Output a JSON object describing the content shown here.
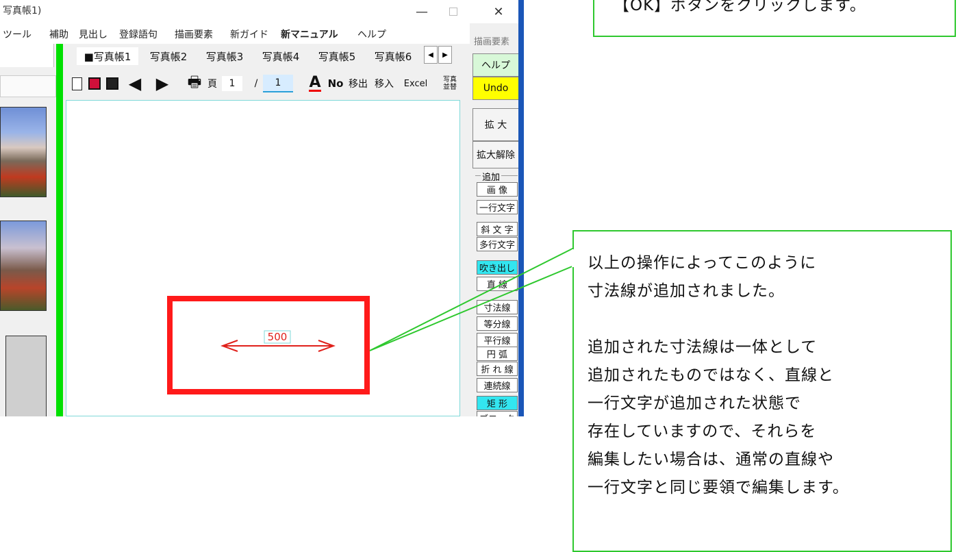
{
  "window": {
    "title": "写真帳1)",
    "minimize_icon": "minimize-icon",
    "maximize_icon": "maximize-icon",
    "close_icon": "close-icon"
  },
  "menu": [
    "ツール",
    "補助",
    "見出し",
    "登録語句",
    "描画要素",
    "新ガイド",
    "新マニュアル",
    "ヘルプ"
  ],
  "tabs": [
    "■写真帳1",
    "写真帳2",
    "写真帳3",
    "写真帳4",
    "写真帳5",
    "写真帳6"
  ],
  "toolbar": {
    "page_label": "頁",
    "page_current": "1",
    "page_separator": "/",
    "page_total": "1",
    "move_out": "移出",
    "move_in": "移入",
    "excel": "Excel",
    "photo_sort_1": "写真",
    "photo_sort_2": "並替",
    "number_icon": "No"
  },
  "right_panel": {
    "header": "描画要素",
    "help": "ヘルプ",
    "undo": "Undo",
    "zoom": "拡 大",
    "zoom_off": "拡大解除",
    "add_label": "追加",
    "items": [
      "画 像",
      "一行文字",
      "斜 文 字",
      "多行文字",
      "吹き出し",
      "直 線",
      "寸法線",
      "等分線",
      "平行線",
      "円 弧",
      "折 れ 線",
      "連続線",
      "矩 形",
      "ブロック"
    ]
  },
  "canvas": {
    "dimension_value": "500"
  },
  "callout_top": "【OK】ボタンをクリックします。",
  "callout_main": {
    "lines": [
      "以上の操作によってこのように",
      "寸法線が追加されました。",
      "",
      "追加された寸法線は一体として",
      "追加されたものではなく、直線と",
      "一行文字が追加された状態で",
      "存在していますので、それらを",
      "編集したい場合は、通常の直線や",
      "一行文字と同じ要領で編集します。"
    ]
  },
  "colors": {
    "highlight_red": "#ff1a1a",
    "callout_green": "#2ec82e",
    "undo_yellow": "#ffff00",
    "active_cyan": "#33e6f0"
  }
}
